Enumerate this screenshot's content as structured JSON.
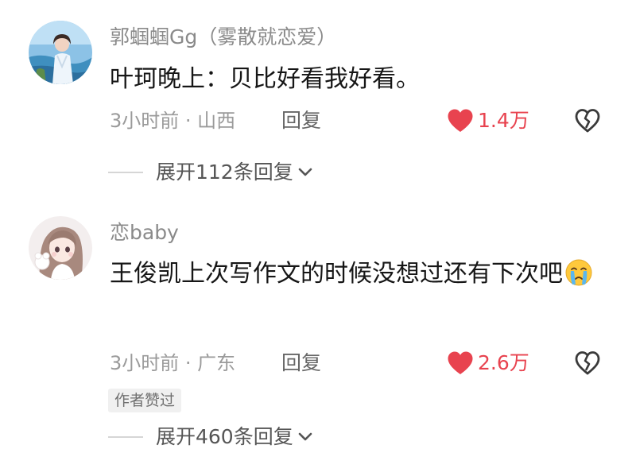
{
  "comments": [
    {
      "username": "郭蝈蝈Gg（雾散就恋爱）",
      "text": "叶珂晚上：贝比好看我好看。",
      "meta": "3小时前 · 山西",
      "reply_label": "回复",
      "likes": "1.4万",
      "expand_label": "展开112条回复"
    },
    {
      "username": "恋baby",
      "text": "王俊凯上次写作文的时候没想过还有下次吧",
      "meta": "3小时前 · 广东",
      "reply_label": "回复",
      "likes": "2.6万",
      "badge": "作者赞过",
      "expand_label": "展开460条回复"
    }
  ],
  "icons": {
    "like": "heart-icon",
    "dislike": "broken-heart-icon",
    "expand": "chevron-down-icon",
    "emoji": "crying-face-emoji"
  },
  "colors": {
    "like_red": "#e8434f",
    "username_gray": "#8a8a8a",
    "text_black": "#161616"
  }
}
